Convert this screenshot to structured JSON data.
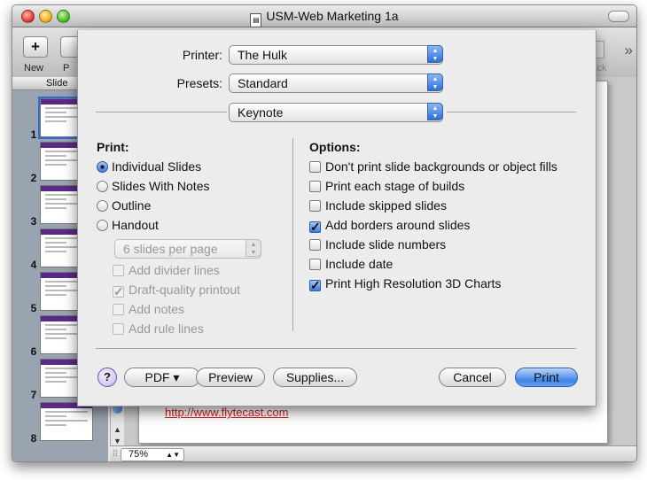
{
  "window": {
    "title": "USM-Web Marketing 1a"
  },
  "toolbar": {
    "new_label": "New",
    "second_label": "P",
    "back_label": "Back",
    "overflow": "»"
  },
  "sidebar": {
    "header": "Slide",
    "slides": [
      "1",
      "2",
      "3",
      "4",
      "5",
      "6",
      "7",
      "8"
    ]
  },
  "canvas": {
    "link_text": "http://www.flytecast.com"
  },
  "status": {
    "zoom": "75%"
  },
  "print": {
    "printer_label": "Printer:",
    "printer_value": "The Hulk",
    "presets_label": "Presets:",
    "presets_value": "Standard",
    "pane_value": "Keynote",
    "print_section": "Print:",
    "print_options": [
      {
        "label": "Individual Slides",
        "selected": true
      },
      {
        "label": "Slides With Notes",
        "selected": false
      },
      {
        "label": "Outline",
        "selected": false
      },
      {
        "label": "Handout",
        "selected": false
      }
    ],
    "handout_layout": "6 slides per page",
    "handout_options": [
      {
        "label": "Add divider lines",
        "checked": false
      },
      {
        "label": "Draft-quality printout",
        "checked": true
      },
      {
        "label": "Add notes",
        "checked": false
      },
      {
        "label": "Add rule lines",
        "checked": false
      }
    ],
    "options_section": "Options:",
    "options": [
      {
        "label": "Don't print slide backgrounds or object fills",
        "checked": false
      },
      {
        "label": "Print each stage of builds",
        "checked": false
      },
      {
        "label": "Include skipped slides",
        "checked": false
      },
      {
        "label": "Add borders around slides",
        "checked": true
      },
      {
        "label": "Include slide numbers",
        "checked": false
      },
      {
        "label": "Include date",
        "checked": false
      },
      {
        "label": "Print High Resolution 3D Charts",
        "checked": true
      }
    ],
    "help": "?",
    "pdf_button": "PDF ▾",
    "preview_button": "Preview",
    "supplies_button": "Supplies...",
    "cancel_button": "Cancel",
    "print_button": "Print"
  }
}
